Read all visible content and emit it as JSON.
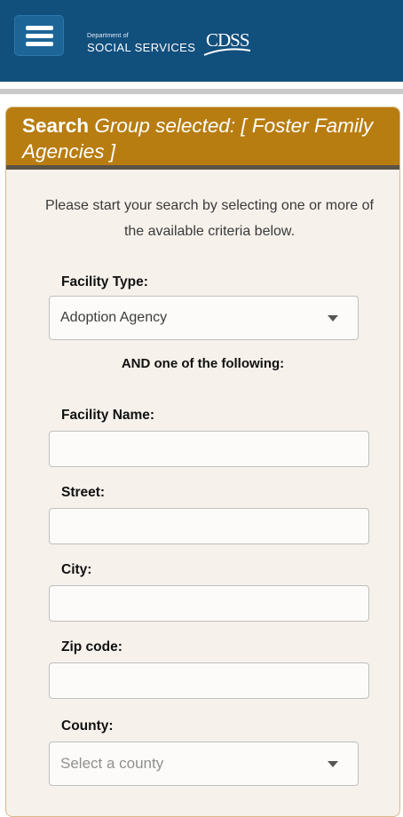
{
  "header": {
    "logo": {
      "line1": "Department of",
      "line2": "SOCIAL SERVICES",
      "acronym": "CDSS"
    }
  },
  "search": {
    "title": "Search",
    "group_text": "Group selected: [ Foster Family Agencies ]",
    "intro": "Please start your search by selecting one or more of the available criteria below.",
    "facility_type": {
      "label": "Facility Type:",
      "selected": "Adoption Agency"
    },
    "and_text": "AND one of the following:",
    "facility_name": {
      "label": "Facility Name:",
      "value": ""
    },
    "street": {
      "label": "Street:",
      "value": ""
    },
    "city": {
      "label": "City:",
      "value": ""
    },
    "zip": {
      "label": "Zip code:",
      "value": ""
    },
    "county": {
      "label": "County:",
      "placeholder": "Select a county"
    }
  },
  "colors": {
    "top_bar": "#114f7d",
    "card_header": "#b87d11",
    "card_bg": "#f6f1eb"
  }
}
